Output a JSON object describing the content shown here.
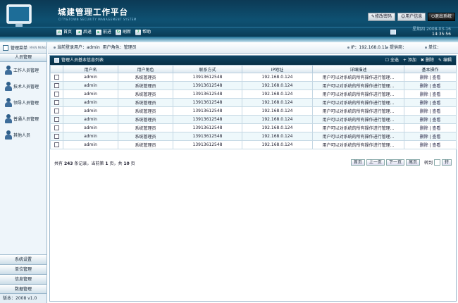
{
  "header": {
    "title": "城建管理工作平台",
    "subtitle": "CITY&TOWN SECURITY MANAGEMENT SYSTEM",
    "buttons": {
      "change_password": "修改密码",
      "user_info": "用户信息",
      "logout": "退出系统"
    }
  },
  "nav": {
    "items": [
      {
        "label": "首页",
        "icon": "home-icon"
      },
      {
        "label": "后退",
        "icon": "back-icon"
      },
      {
        "label": "前进",
        "icon": "forward-icon"
      },
      {
        "label": "刷新",
        "icon": "refresh-icon"
      },
      {
        "label": "帮助",
        "icon": "help-icon"
      }
    ],
    "date": "星期四 2008-03-16",
    "time": "14:35:56"
  },
  "sidebar": {
    "header_label": "管理菜单",
    "header_sub": "MAIN MENU",
    "section": "人员管理",
    "items": [
      {
        "label": "工作人员管理"
      },
      {
        "label": "技术人员管理"
      },
      {
        "label": "领导人员管理"
      },
      {
        "label": "普通人员管理"
      },
      {
        "label": "其他人员"
      }
    ],
    "bottom": [
      "系统设置",
      "单位管理",
      "信息管理",
      "数据管理"
    ],
    "version": "版本：2008 v1.0"
  },
  "login": {
    "user_prefix": "当前登录用户：",
    "user": "admin",
    "role_prefix": "用户角色：",
    "role": "管理员",
    "ip": "IP：192.168.0.11",
    "address": "提供商：",
    "unit": "单位："
  },
  "panel": {
    "title": "管理人员基本信息列表",
    "actions": {
      "select_all": "全选",
      "add": "添加",
      "delete": "删除",
      "edit": "编辑"
    }
  },
  "table": {
    "columns": [
      "",
      "用户名",
      "用户角色",
      "联系方式",
      "IP地址",
      "详细描述",
      "基本操作"
    ],
    "rows": [
      [
        "admin",
        "系统管理员",
        "13913612548",
        "192.168.0.124",
        "用户可以对系统的所有操作进行管理..."
      ],
      [
        "admin",
        "系统管理员",
        "13913612548",
        "192.168.0.124",
        "用户可以对系统的所有操作进行管理..."
      ],
      [
        "admin",
        "系统管理员",
        "13913612548",
        "192.168.0.124",
        "用户可以对系统的所有操作进行管理..."
      ],
      [
        "admin",
        "系统管理员",
        "13913612548",
        "192.168.0.124",
        "用户可以对系统的所有操作进行管理..."
      ],
      [
        "admin",
        "系统管理员",
        "13913612548",
        "192.168.0.124",
        "用户可以对系统的所有操作进行管理..."
      ],
      [
        "admin",
        "系统管理员",
        "13913612548",
        "192.168.0.124",
        "用户可以对系统的所有操作进行管理..."
      ],
      [
        "admin",
        "系统管理员",
        "13913612548",
        "192.168.0.124",
        "用户可以对系统的所有操作进行管理..."
      ],
      [
        "admin",
        "系统管理员",
        "13913612548",
        "192.168.0.124",
        "用户可以对系统的所有操作进行管理..."
      ],
      [
        "admin",
        "系统管理员",
        "13913612548",
        "192.168.0.124",
        "用户可以对系统的所有操作进行管理..."
      ]
    ],
    "op_delete": "删除",
    "op_view": "查看"
  },
  "pager": {
    "text_before": "共有",
    "total": "243",
    "text_mid": "条记录，当前第",
    "current": "1",
    "text_mid2": "页，共",
    "pages": "10",
    "text_after": "页",
    "first": "首页",
    "prev": "上一页",
    "next": "下一页",
    "last": "尾页",
    "goto": "转到",
    "go": "转"
  }
}
